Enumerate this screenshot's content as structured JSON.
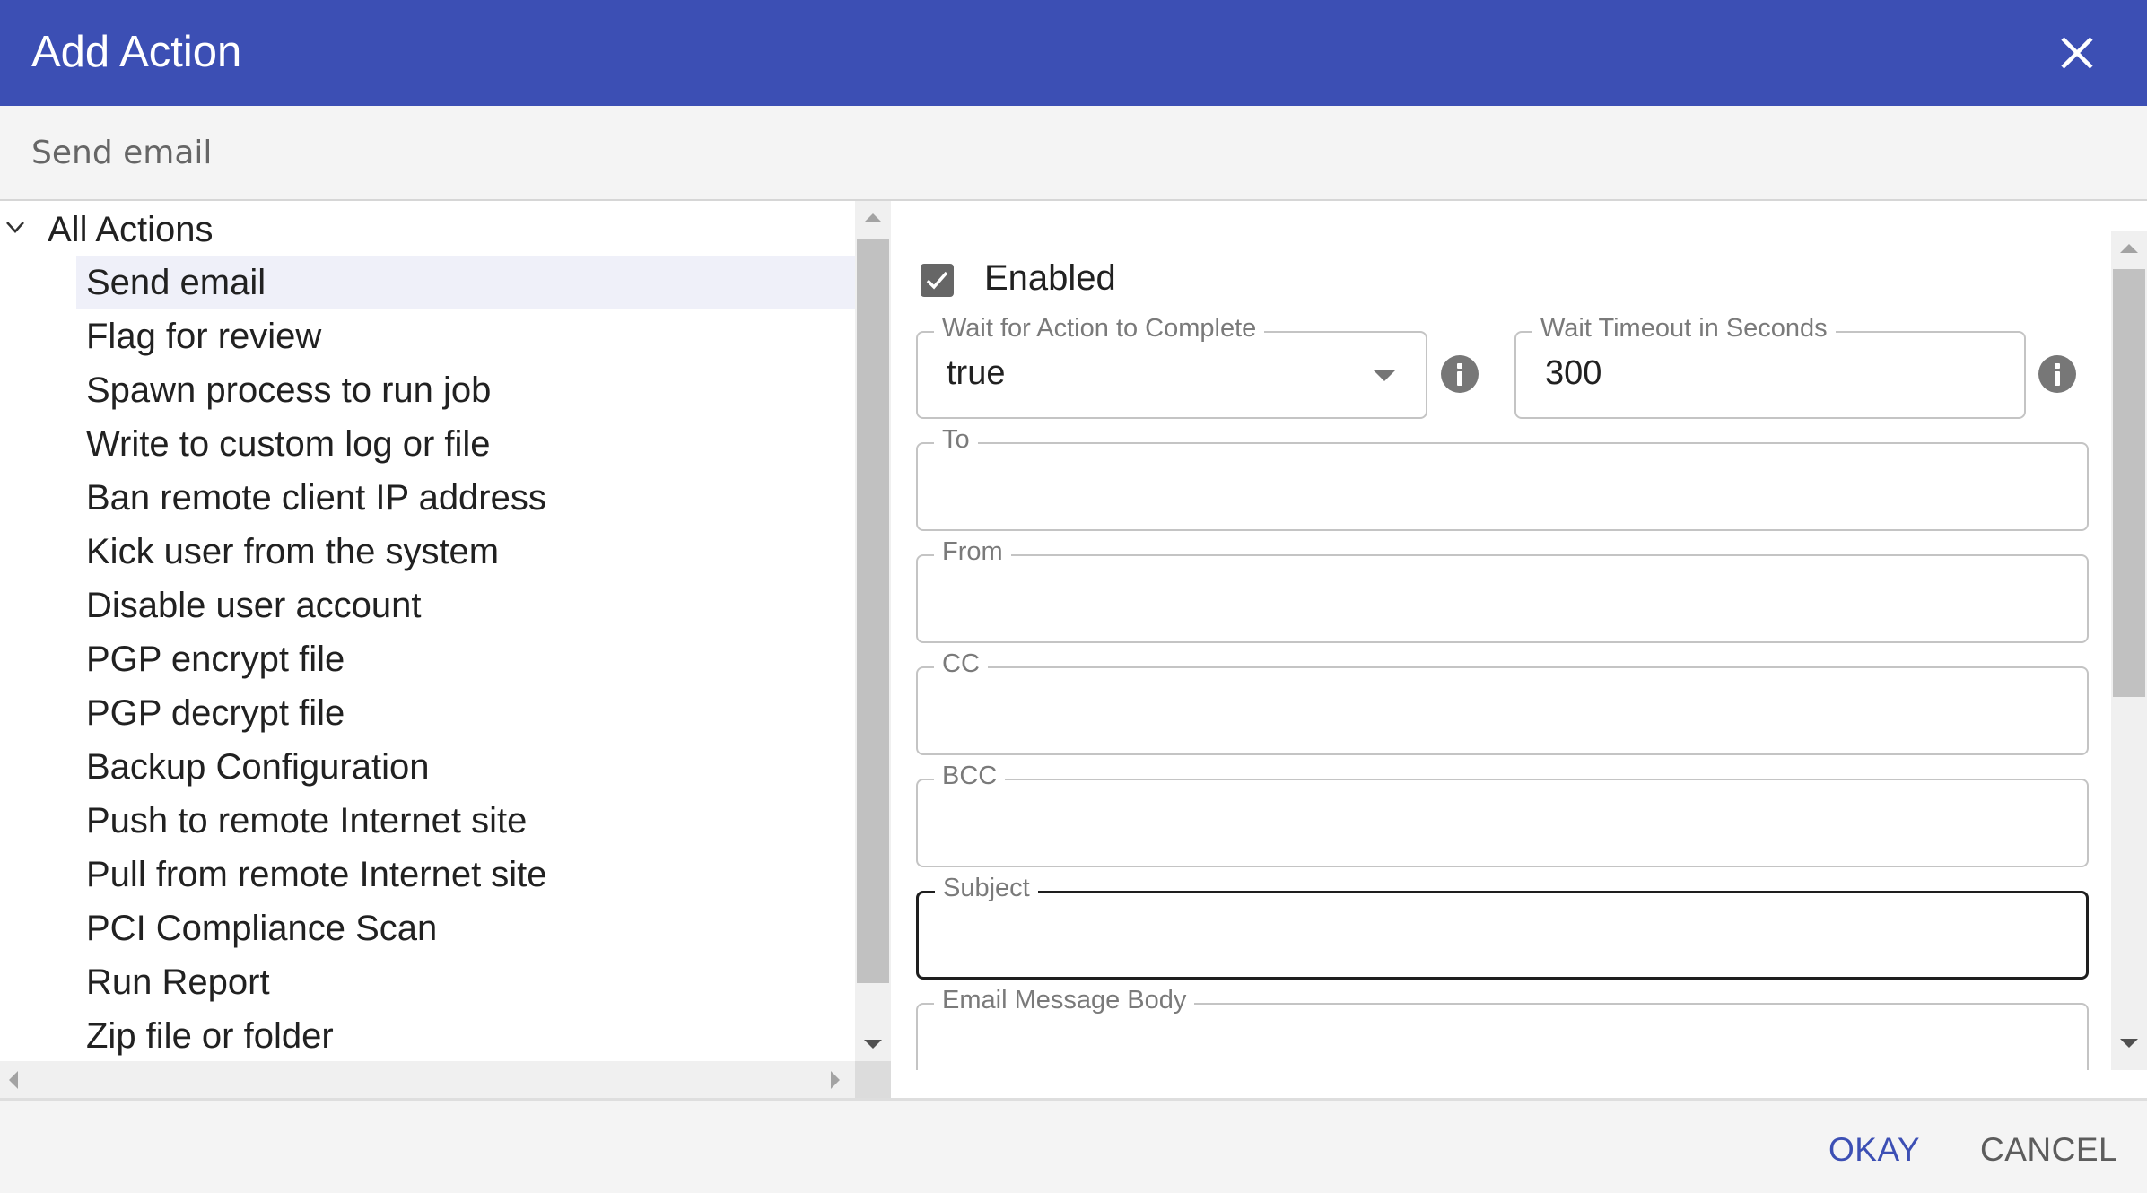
{
  "dialog": {
    "title": "Add Action",
    "close_icon": "close-icon",
    "selected_action": "Send email"
  },
  "tree": {
    "root_label": "All Actions",
    "root_expanded": true,
    "selected_index": 0,
    "items": [
      {
        "label": "Send email"
      },
      {
        "label": "Flag for review"
      },
      {
        "label": "Spawn process to run job"
      },
      {
        "label": "Write to custom log or file"
      },
      {
        "label": "Ban remote client IP address"
      },
      {
        "label": "Kick user from the system"
      },
      {
        "label": "Disable user account"
      },
      {
        "label": "PGP encrypt file"
      },
      {
        "label": "PGP decrypt file"
      },
      {
        "label": "Backup Configuration"
      },
      {
        "label": "Push to remote Internet site"
      },
      {
        "label": "Pull from remote Internet site"
      },
      {
        "label": "PCI Compliance Scan"
      },
      {
        "label": "Run Report"
      },
      {
        "label": "Zip file or folder"
      }
    ]
  },
  "form": {
    "enabled": {
      "label": "Enabled",
      "checked": true
    },
    "wait_for_complete": {
      "label": "Wait for Action to Complete",
      "value": "true",
      "info_icon": "info-icon"
    },
    "wait_timeout": {
      "label": "Wait Timeout in Seconds",
      "value": "300",
      "info_icon": "info-icon"
    },
    "to": {
      "label": "To",
      "value": ""
    },
    "from": {
      "label": "From",
      "value": ""
    },
    "cc": {
      "label": "CC",
      "value": ""
    },
    "bcc": {
      "label": "BCC",
      "value": ""
    },
    "subject": {
      "label": "Subject",
      "value": "",
      "focused": true
    },
    "body": {
      "label": "Email Message Body",
      "value": ""
    }
  },
  "footer": {
    "okay_label": "OKAY",
    "cancel_label": "CANCEL"
  },
  "colors": {
    "header_bg": "#3c4fb4",
    "primary": "#3c4fb4",
    "selected_row_bg": "#eff0f9",
    "checkbox_bg": "#666666"
  }
}
